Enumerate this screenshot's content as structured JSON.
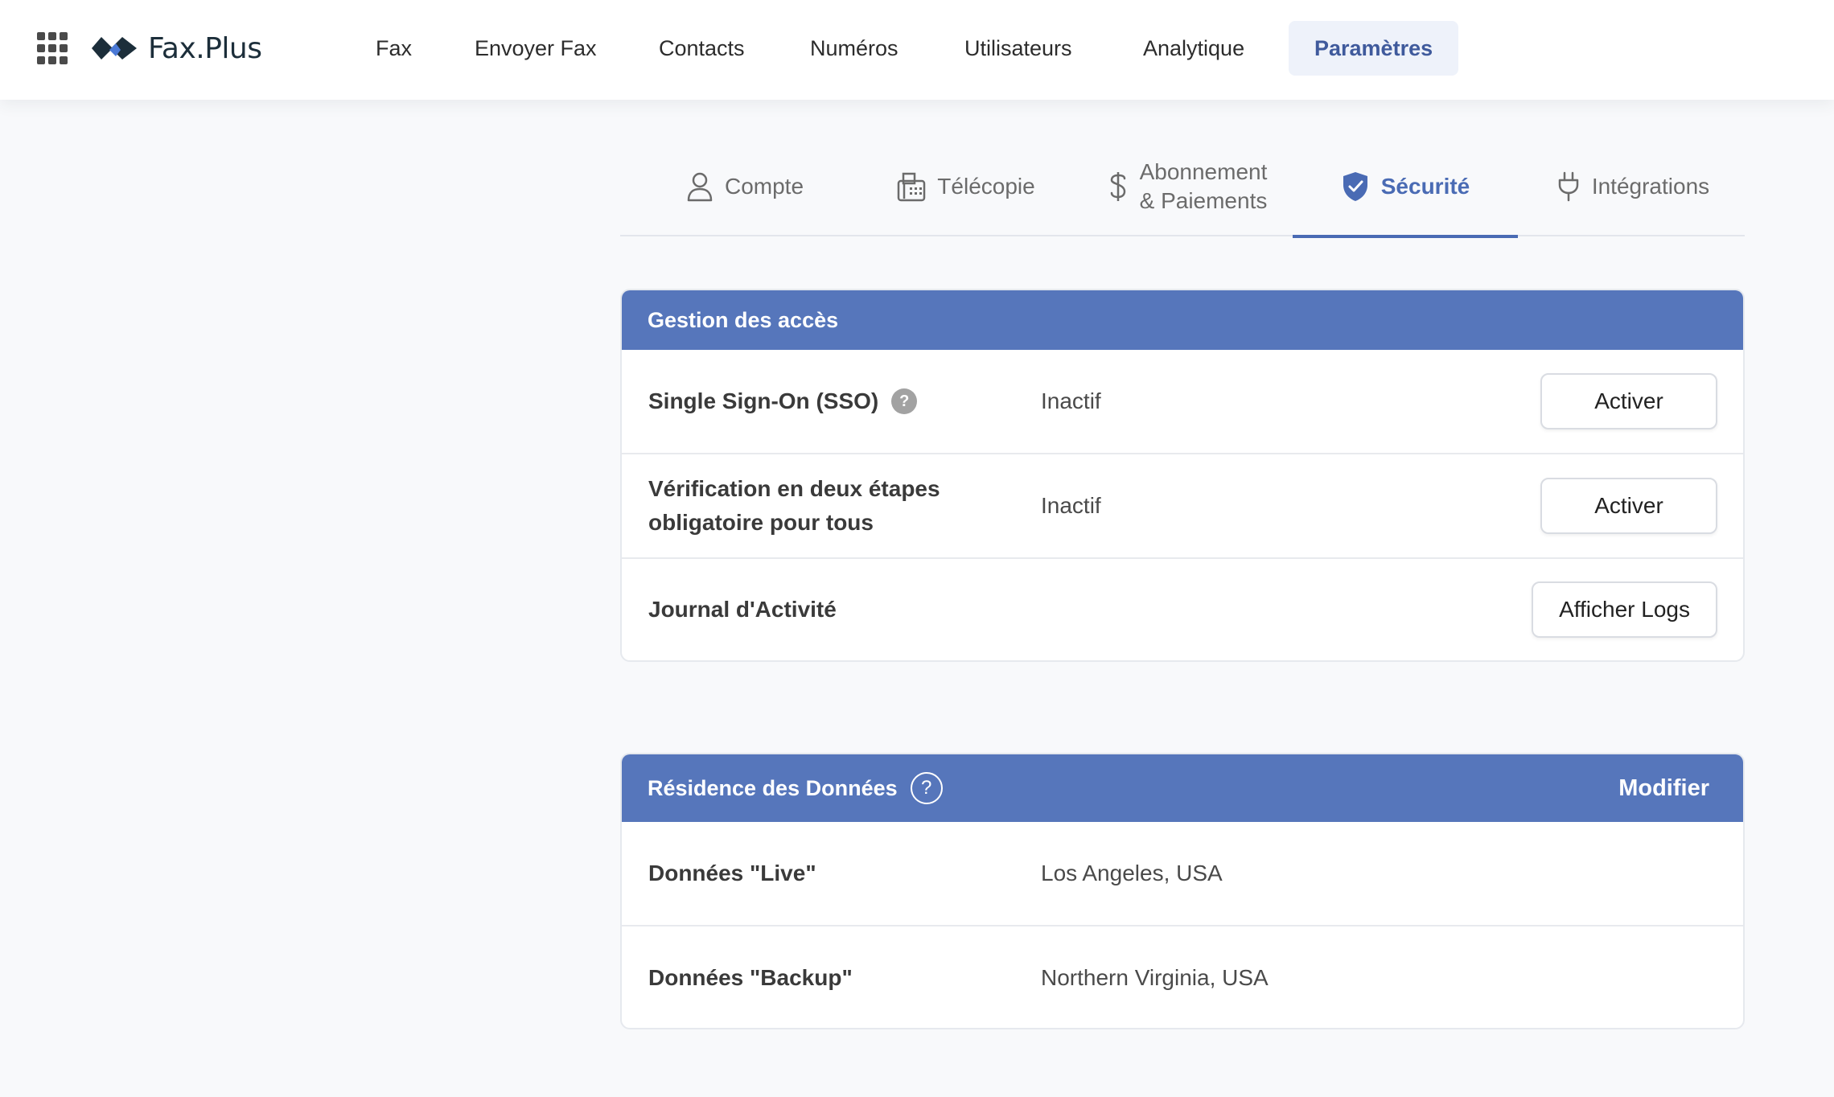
{
  "header": {
    "apps_icon": "grid-apps-icon",
    "logo_text": "Fax.Plus",
    "nav": [
      {
        "label": "Fax"
      },
      {
        "label": "Envoyer Fax"
      },
      {
        "label": "Contacts"
      },
      {
        "label": "Numéros"
      },
      {
        "label": "Utilisateurs"
      },
      {
        "label": "Analytique"
      },
      {
        "label": "Paramètres",
        "active": true
      }
    ]
  },
  "tabs": [
    {
      "label": "Compte",
      "icon": "user-icon"
    },
    {
      "label": "Télécopie",
      "icon": "fax-machine-icon"
    },
    {
      "label_line1": "Abonnement",
      "label_line2": "& Paiements",
      "icon": "dollar-icon"
    },
    {
      "label": "Sécurité",
      "icon": "shield-check-icon",
      "active": true
    },
    {
      "label": "Intégrations",
      "icon": "plug-icon"
    }
  ],
  "access": {
    "title": "Gestion des accès",
    "rows": [
      {
        "label": "Single Sign-On (SSO)",
        "status": "Inactif",
        "button": "Activer"
      },
      {
        "label": "Vérification en deux étapes obligatoire pour tous",
        "status": "Inactif",
        "button": "Activer"
      },
      {
        "label": "Journal d'Activité",
        "status": "",
        "button": "Afficher Logs"
      }
    ]
  },
  "residency": {
    "title": "Résidence des Données",
    "action": "Modifier",
    "rows": [
      {
        "label": "Données \"Live\"",
        "value": "Los Angeles, USA"
      },
      {
        "label": "Données \"Backup\"",
        "value": "Northern Virginia, USA"
      }
    ]
  },
  "colors": {
    "accent": "#4a6bb4",
    "card_header": "#5676bb",
    "nav_active_bg": "#eef2fa",
    "logo_dark": "#1c2e3a",
    "logo_blue": "#4a79d6"
  }
}
